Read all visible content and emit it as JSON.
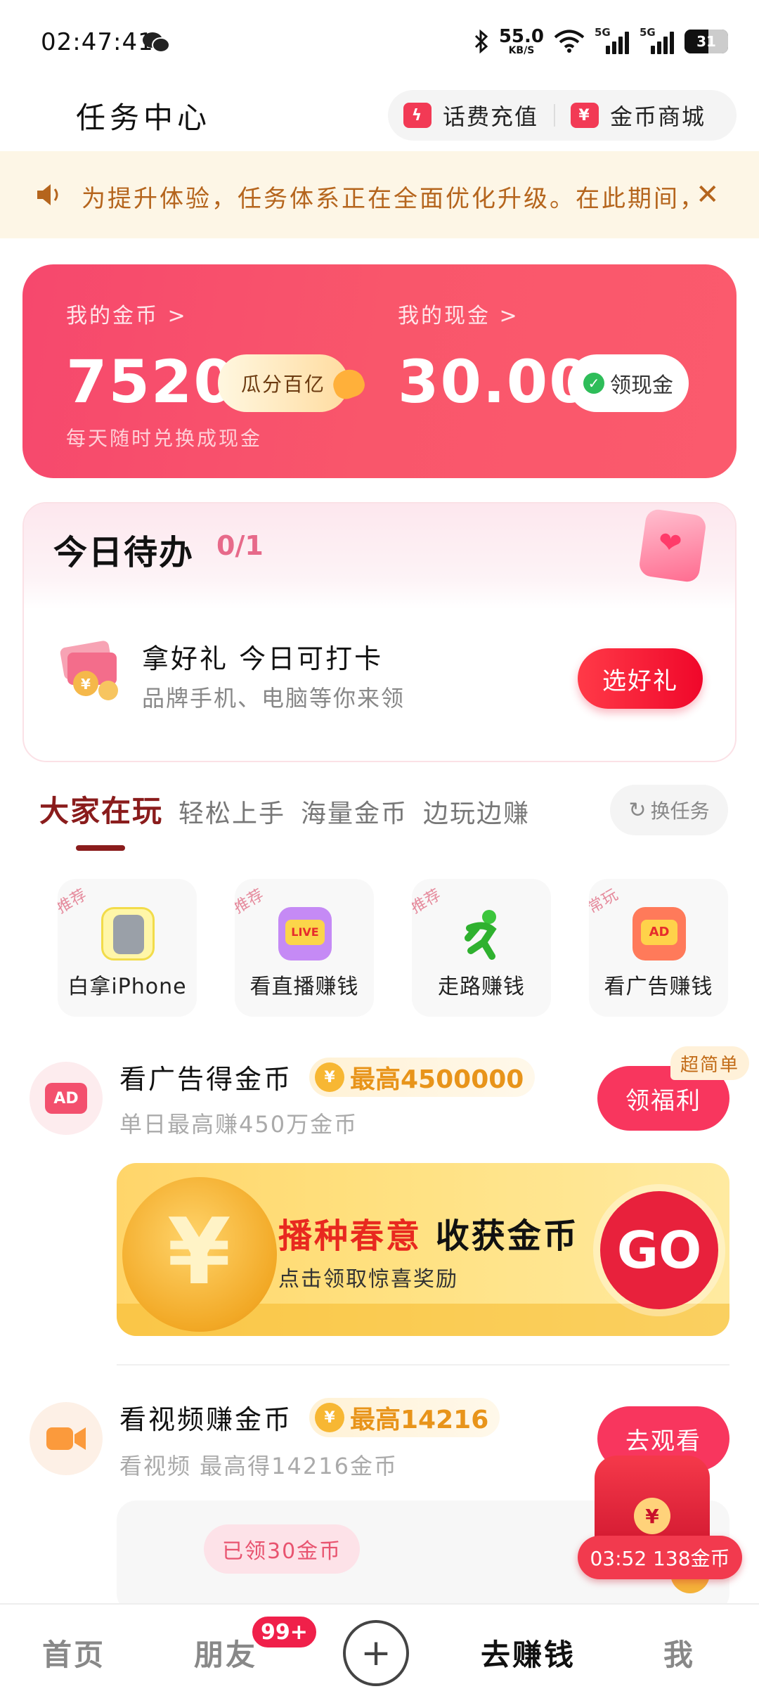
{
  "status": {
    "time": "02:47:41",
    "net_speed": "55.0",
    "net_unit": "KB/S",
    "sig1": "5G",
    "sig2": "5G",
    "battery": "31"
  },
  "header": {
    "title": "任务中心",
    "recharge": "话费充值",
    "mall": "金币商城"
  },
  "notice": {
    "text": "为提升体验，任务体系正在全面优化升级。在此期间，"
  },
  "wallet": {
    "coins_label": "我的金币 >",
    "coins": "7520",
    "split_button": "瓜分百亿",
    "cash_label": "我的现金 >",
    "cash": "30.00",
    "cash_button": "领现金",
    "sub": "每天随时兑换成现金"
  },
  "todo": {
    "title": "今日待办",
    "count": "0/1",
    "item_title": "拿好礼 今日可打卡",
    "item_desc": "品牌手机、电脑等你来领",
    "button": "选好礼"
  },
  "tabs": {
    "items": [
      "大家在玩",
      "轻松上手",
      "海量金币",
      "边玩边赚"
    ],
    "swap": "换任务"
  },
  "grid": [
    {
      "tag": "推荐",
      "label": "白拿iPhone"
    },
    {
      "tag": "推荐",
      "label": "看直播赚钱"
    },
    {
      "tag": "推荐",
      "label": "走路赚钱"
    },
    {
      "tag": "常玩",
      "label": "看广告赚钱"
    }
  ],
  "task_ad": {
    "title": "看广告得金币",
    "max": "最高4500000",
    "desc": "单日最高赚450万金币",
    "button": "领福利",
    "tag": "超简单",
    "icon": "AD"
  },
  "banner": {
    "title_red": "播种春意",
    "title_dark": "收获金币",
    "sub": "点击领取惊喜奖励",
    "go": "GO"
  },
  "task_video": {
    "title": "看视频赚金币",
    "max": "最高14216",
    "desc": "看视频 最高得14216金币",
    "button": "去观看",
    "claimed": "已领30金币"
  },
  "float": {
    "timer": "03:52 138金币"
  },
  "nav": {
    "home": "首页",
    "friends": "朋友",
    "badge": "99+",
    "earn": "去赚钱",
    "me": "我"
  },
  "colors": {
    "primary": "#f8365e",
    "notice_bg": "#fdf6e6",
    "notice_text": "#b5651d",
    "coin_gold": "#e8941a"
  }
}
